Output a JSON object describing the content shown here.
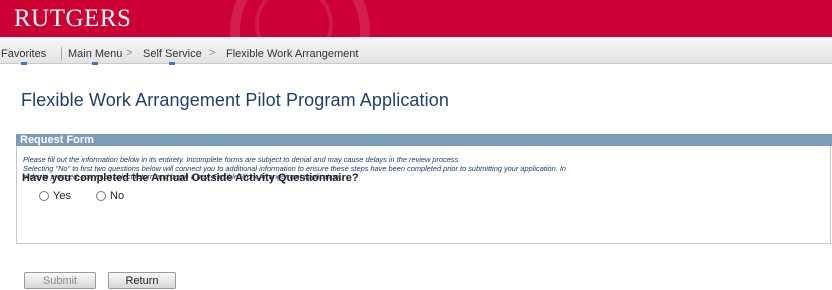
{
  "brand": {
    "logo_text": "RUTGERS",
    "color": "#cc0033"
  },
  "nav": {
    "items": [
      "Favorites",
      "Main Menu",
      "Self Service",
      "Flexible Work Arrangement"
    ],
    "separator": ">"
  },
  "page": {
    "title": "Flexible Work Arrangement Pilot Program Application"
  },
  "form": {
    "section_title": "Request Form",
    "instructions": [
      "Please fill out the information below in its entirety. Incomplete forms are subject to denial and may cause delays in the review process.",
      "Selecting \"No\" to first two questions below will connect you to additional information to ensure these steps have been completed prior to submitting your application. In",
      "order to proceed, you must select return and begin a new Flexible Work Arrangement application."
    ],
    "question": "Have you completed the Annual Outside Activity Questionnaire?",
    "options": [
      "Yes",
      "No"
    ]
  },
  "buttons": {
    "submit": "Submit",
    "return": "Return"
  },
  "colors": {
    "title": "#1e3f6e",
    "section_header": "#7c9cbd",
    "instructions": "#1a3b70"
  }
}
